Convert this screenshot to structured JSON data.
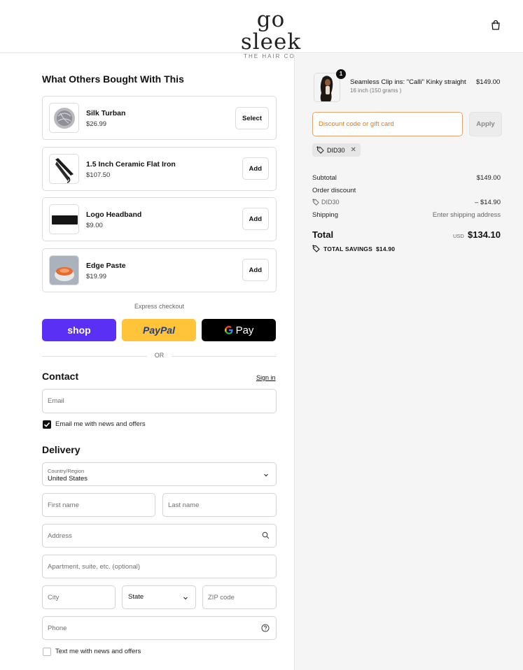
{
  "header": {
    "logo_main": "go sleek",
    "logo_sub": "THE HAIR CO.",
    "cart_icon": "shopping-bag-icon"
  },
  "upsell": {
    "title": "What Others Bought With This",
    "items": [
      {
        "name": "Silk Turban",
        "price": "$26.99",
        "button": "Select"
      },
      {
        "name": "1.5 Inch Ceramic Flat Iron",
        "price": "$107.50",
        "button": "Add"
      },
      {
        "name": "Logo Headband",
        "price": "$9.00",
        "button": "Add"
      },
      {
        "name": "Edge Paste",
        "price": "$19.99",
        "button": "Add"
      }
    ]
  },
  "express": {
    "label": "Express checkout",
    "shop_label": "shop",
    "paypal_label": "PayPal",
    "gpay_label": "Pay",
    "or_label": "OR"
  },
  "contact": {
    "title": "Contact",
    "sign_in": "Sign in",
    "email_placeholder": "Email",
    "news_label": "Email me with news and offers",
    "news_checked": true
  },
  "delivery": {
    "title": "Delivery",
    "country_label": "Country/Region",
    "country_value": "United States",
    "first_name_placeholder": "First name",
    "last_name_placeholder": "Last name",
    "address_placeholder": "Address",
    "apartment_placeholder": "Apartment, suite, etc. (optional)",
    "city_placeholder": "City",
    "state_label": "State",
    "zip_placeholder": "ZIP code",
    "phone_placeholder": "Phone",
    "sms_label": "Text me with news and offers",
    "sms_checked": false
  },
  "summary": {
    "product": {
      "name": "Seamless Clip ins: \"Calli\" Kinky straight",
      "variant": "16 inch (150 grams )",
      "price": "$149.00",
      "quantity": "1"
    },
    "discount_placeholder": "Discount code or gift card",
    "apply_label": "Apply",
    "code": "DID30",
    "subtotal_label": "Subtotal",
    "subtotal_value": "$149.00",
    "order_discount_label": "Order discount",
    "discount_code": "DID30",
    "discount_value": "– $14.90",
    "shipping_label": "Shipping",
    "shipping_value": "Enter shipping address",
    "total_label": "Total",
    "currency": "USD",
    "total_value": "$134.10",
    "savings_label": "TOTAL SAVINGS",
    "savings_value": "$14.90"
  },
  "colors": {
    "shop_pay": "#5a31f4",
    "paypal": "#ffc439",
    "gpay": "#000000",
    "discount_accent": "#e07b13"
  }
}
